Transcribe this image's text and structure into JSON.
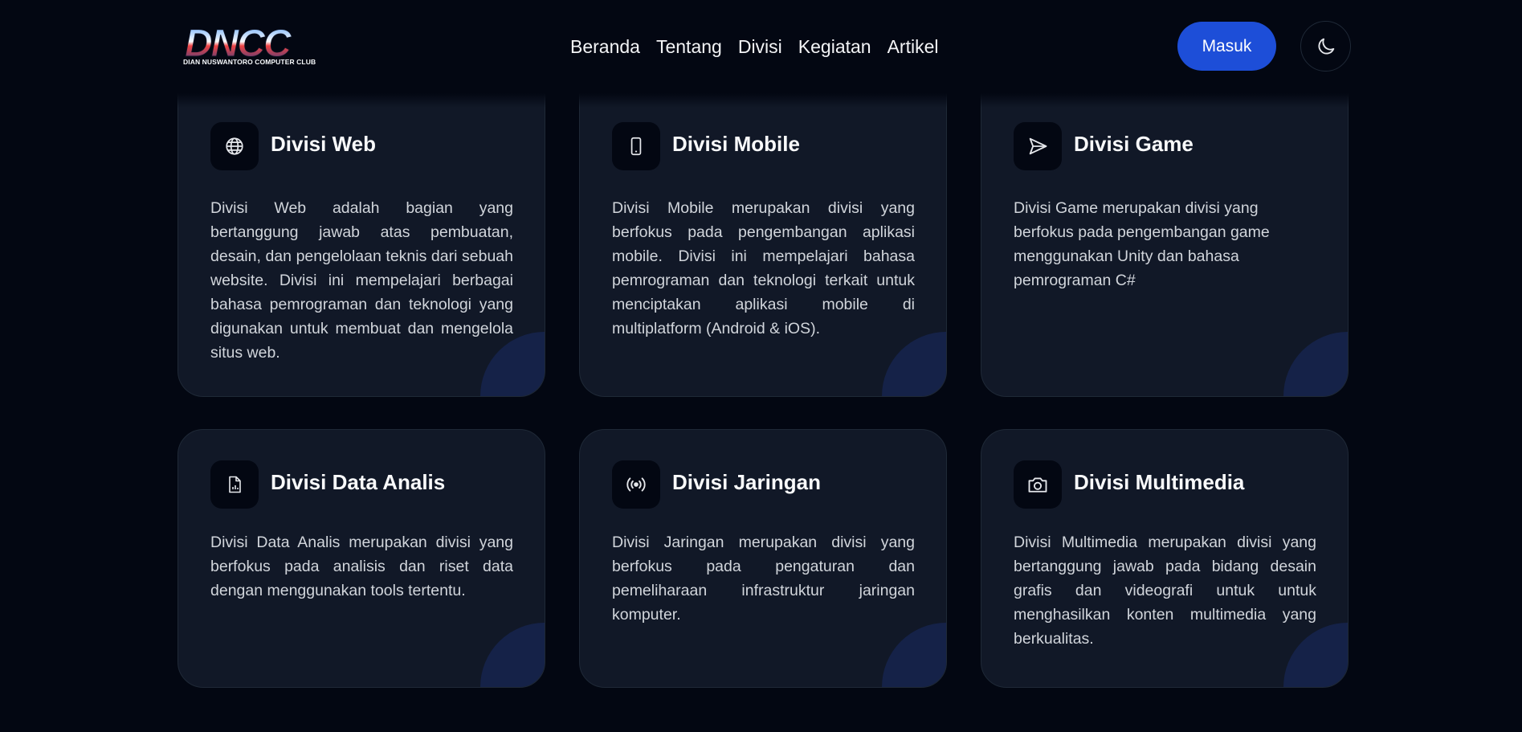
{
  "logo": {
    "text": "DNCC",
    "subtitle": "DIAN NUSWANTORO COMPUTER CLUB"
  },
  "nav": {
    "links": [
      "Beranda",
      "Tentang",
      "Divisi",
      "Kegiatan",
      "Artikel"
    ],
    "login_label": "Masuk",
    "theme_icon": "moon-icon"
  },
  "divisions": [
    {
      "title": "Divisi Web",
      "icon": "globe-icon",
      "description": "Divisi Web adalah bagian yang bertanggung jawab atas pembuatan, desain, dan pengelolaan teknis dari sebuah website. Divisi ini mempelajari berbagai bahasa pemrograman dan teknologi yang digunakan untuk membuat dan mengelola situs web."
    },
    {
      "title": "Divisi Mobile",
      "icon": "smartphone-icon",
      "description": "Divisi Mobile merupakan divisi yang berfokus pada pengembangan aplikasi mobile. Divisi ini mempelajari bahasa pemrograman dan teknologi terkait untuk menciptakan aplikasi mobile di multiplatform (Android & iOS)."
    },
    {
      "title": "Divisi Game",
      "icon": "send-icon",
      "description": "Divisi Game merupakan divisi yang berfokus pada pengembangan game menggunakan Unity dan bahasa pemrograman C#"
    },
    {
      "title": "Divisi Data Analis",
      "icon": "file-chart-icon",
      "description": "Divisi Data Analis merupakan divisi yang berfokus pada analisis dan riset data dengan menggunakan tools tertentu."
    },
    {
      "title": "Divisi Jaringan",
      "icon": "broadcast-icon",
      "description": "Divisi Jaringan merupakan divisi yang berfokus pada pengaturan dan pemeliharaan infrastruktur jaringan komputer."
    },
    {
      "title": "Divisi Multimedia",
      "icon": "camera-icon",
      "description": "Divisi Multimedia merupakan divisi yang bertanggung jawab pada bidang desain grafis dan videografi untuk untuk menghasilkan konten multimedia yang berkualitas."
    }
  ],
  "colors": {
    "background": "#030712",
    "card": "#111827",
    "accent": "#1d4ed8",
    "corner": "#172554"
  }
}
